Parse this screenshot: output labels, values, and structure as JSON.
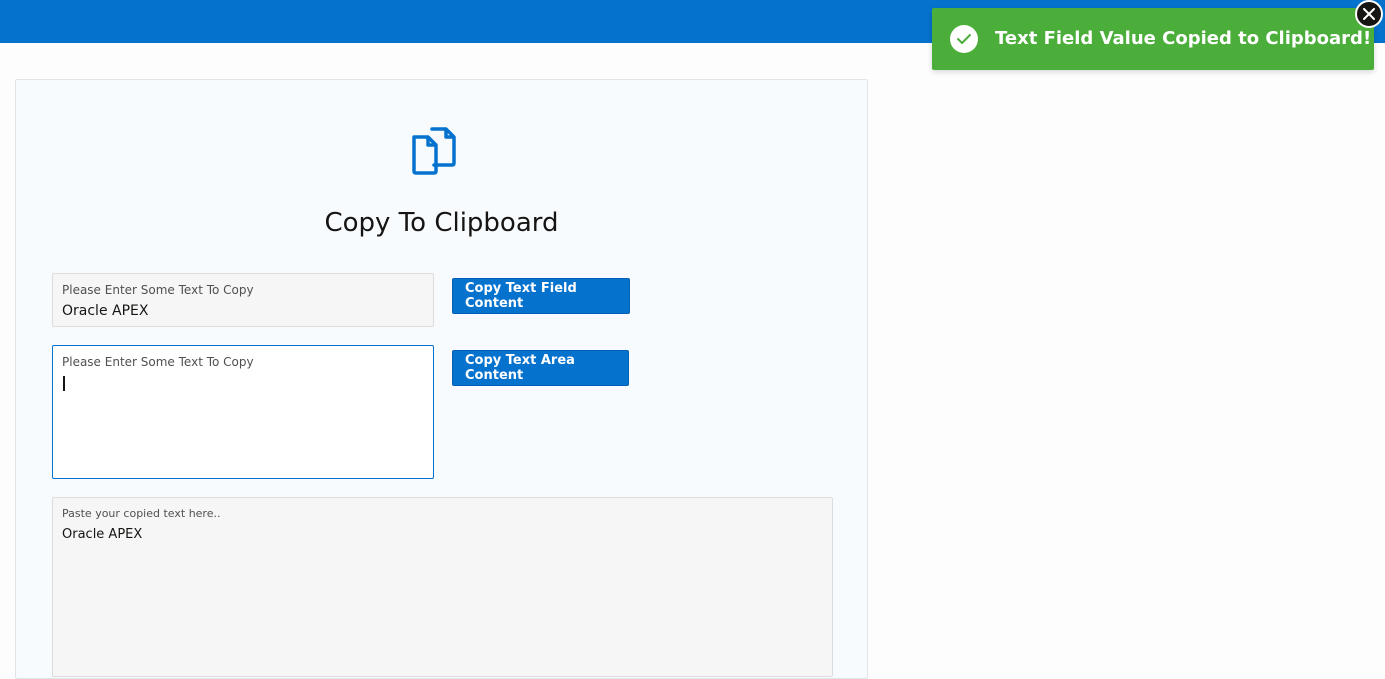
{
  "header": {
    "color": "#0572ce"
  },
  "hero": {
    "icon": "copy-icon",
    "title": "Copy To Clipboard"
  },
  "text_field": {
    "label": "Please Enter Some Text To Copy",
    "value": "Oracle APEX"
  },
  "text_area": {
    "label": "Please Enter Some Text To Copy",
    "value": ""
  },
  "paste_area": {
    "label": "Paste your copied text here..",
    "value": "Oracle APEX"
  },
  "buttons": {
    "copy_text_field": "Copy Text Field Content",
    "copy_text_area": "Copy Text Area Content"
  },
  "toast": {
    "message": "Text Field Value Copied to Clipboard!",
    "color": "#4cae3a",
    "icon": "check-icon",
    "close_icon": "close-icon"
  }
}
